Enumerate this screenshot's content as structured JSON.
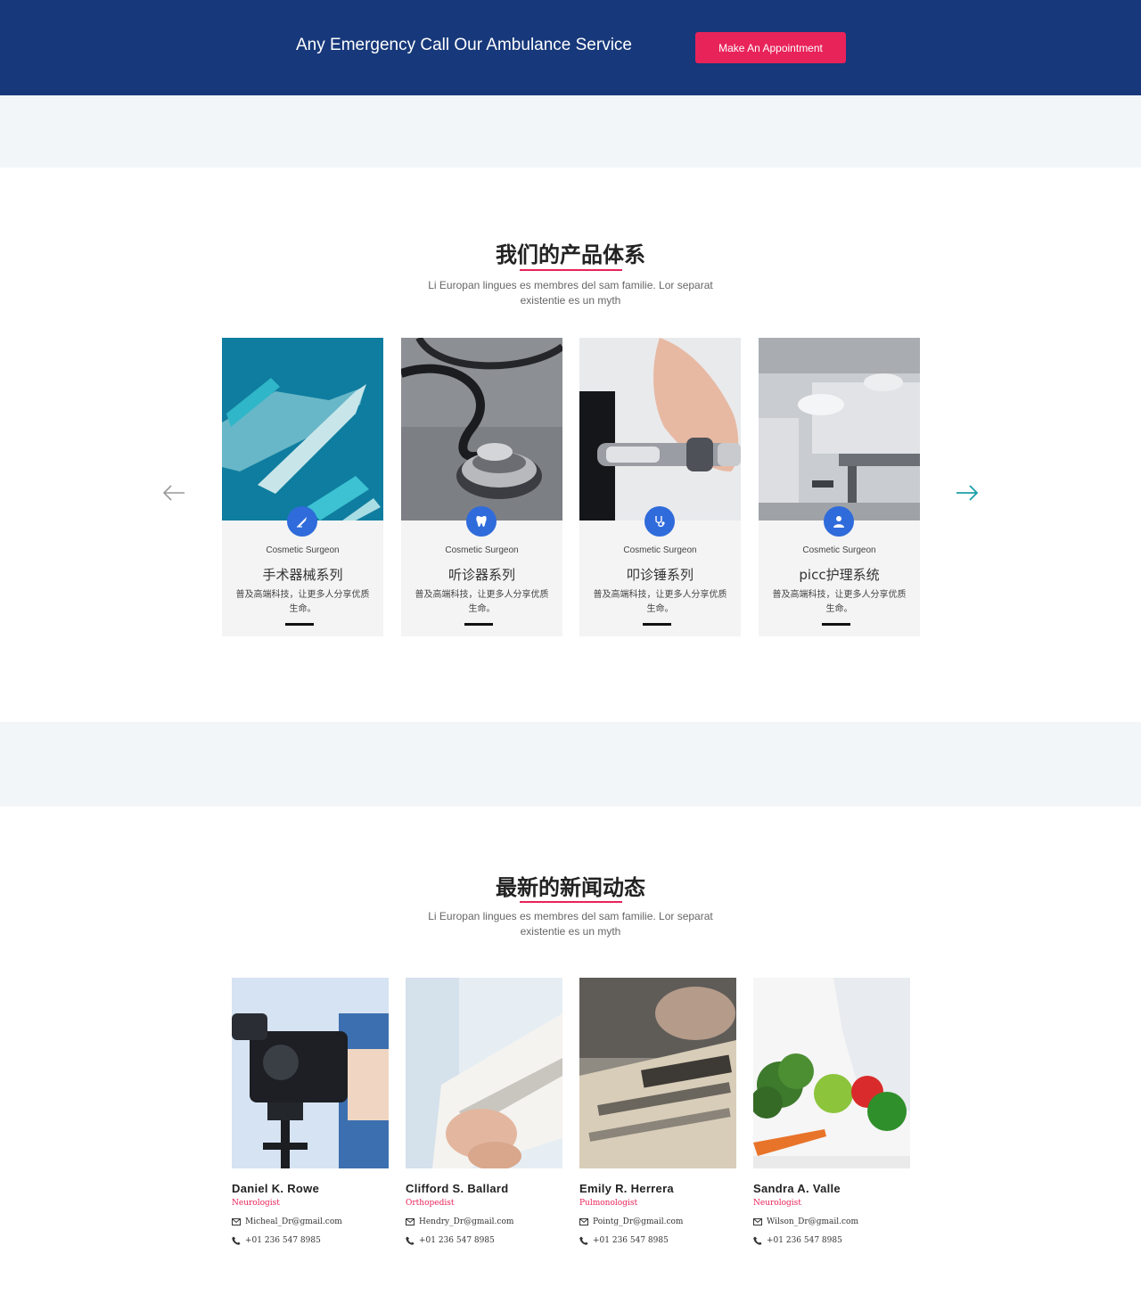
{
  "banner": {
    "text": "Any Emergency Call Our Ambulance Service",
    "button_label": "Make An Appointment"
  },
  "products": {
    "title": "我们的产品体系",
    "subtitle": "Li Europan lingues es membres del sam familie. Lor separat existentie es un myth",
    "cards": [
      {
        "sub": "Cosmetic Surgeon",
        "title": "手术器械系列",
        "desc": "普及高端科技，让更多人分享优质生命。",
        "icon": "scalpel-icon"
      },
      {
        "sub": "Cosmetic Surgeon",
        "title": "听诊器系列",
        "desc": "普及高端科技，让更多人分享优质生命。",
        "icon": "tooth-icon"
      },
      {
        "sub": "Cosmetic Surgeon",
        "title": "叩诊锤系列",
        "desc": "普及高端科技，让更多人分享优质生命。",
        "icon": "stethoscope-icon"
      },
      {
        "sub": "Cosmetic Surgeon",
        "title": "picc护理系统",
        "desc": "普及高端科技，让更多人分享优质生命。",
        "icon": "doctor-icon"
      }
    ]
  },
  "news": {
    "title": "最新的新闻动态",
    "subtitle": "Li Europan lingues es membres del sam familie. Lor separat existentie es un myth",
    "cards": [
      {
        "name": "Daniel K. Rowe",
        "role": "Neurologist",
        "email": "Micheal_Dr@gmail.com",
        "phone": "+01 236 547 8985"
      },
      {
        "name": "Clifford S. Ballard",
        "role": "Orthopedist",
        "email": "Hendry_Dr@gmail.com",
        "phone": "+01 236 547 8985"
      },
      {
        "name": "Emily R. Herrera",
        "role": "Pulmonologist",
        "email": "Pointg_Dr@gmail.com",
        "phone": "+01 236 547 8985"
      },
      {
        "name": "Sandra A. Valle",
        "role": "Neurologist",
        "email": "Wilson_Dr@gmail.com",
        "phone": "+01 236 547 8985"
      }
    ]
  },
  "colors": {
    "banner_bg": "#17387a",
    "accent": "#e8235a",
    "icon_blue": "#2f6bdb",
    "arrow_teal": "#1aa0a8"
  }
}
